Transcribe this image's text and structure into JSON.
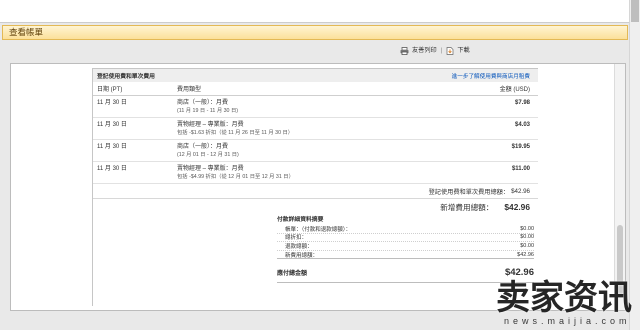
{
  "header": {
    "title": "查看帳單"
  },
  "toolbar": {
    "print_label": "友善列印",
    "separator": "|",
    "download_label": "下載"
  },
  "icons": {
    "print": "printer-icon",
    "download": "download-icon"
  },
  "fees": {
    "section_title": "登記使用費和單次費用",
    "learn_more_link": "進一步了解使用費與商店月租費",
    "columns": {
      "date": "日期 (PT)",
      "type": "費用類型",
      "amount": "金額 (USD)"
    },
    "rows": [
      {
        "date": "11 月 30 日",
        "type": "商店（一般）：月費",
        "detail": "(11 月 19 日 - 11 月 30 日)",
        "amount": "$7.98"
      },
      {
        "date": "11 月 30 日",
        "type": "賣物經理 – 專業版：月費",
        "detail": "包括 -$1.63 折扣（從 11 月 26 日至 11 月 30 日）",
        "amount": "$4.03"
      },
      {
        "date": "11 月 30 日",
        "type": "商店（一般）：月費",
        "detail": "(12 月 01 日 - 12 月 31 日)",
        "amount": "$19.95"
      },
      {
        "date": "11 月 30 日",
        "type": "賣物經理 – 專業版：月費",
        "detail": "包括 -$4.99 折扣（從 12 月 01 日至 12 月 31 日）",
        "amount": "$11.00"
      }
    ],
    "subtotal_label": "登記使用費和單次費用總額：",
    "subtotal_value": "$42.96"
  },
  "new_charges": {
    "label": "新增費用總額：",
    "value": "$42.96"
  },
  "summary": {
    "title": "付款詳細資料摘要",
    "rows": [
      {
        "label": "帳單：（付款和退款總額）：",
        "value": "$0.00"
      },
      {
        "label": "總折扣：",
        "value": "$0.00"
      },
      {
        "label": "退款總額：",
        "value": "$0.00"
      },
      {
        "label": "新費用總額：",
        "value": "$42.96"
      }
    ]
  },
  "total_due": {
    "label": "應付總金額",
    "value": "$42.96"
  },
  "watermark": {
    "brand": "卖家资讯",
    "url": "news.maijia.com"
  },
  "colors": {
    "page_bg": "#e9e9e9",
    "header_bg": "#fbe09a",
    "header_border": "#e3b955",
    "link": "#0654ba",
    "text": "#333333",
    "panel_head": "#eeeeee"
  }
}
